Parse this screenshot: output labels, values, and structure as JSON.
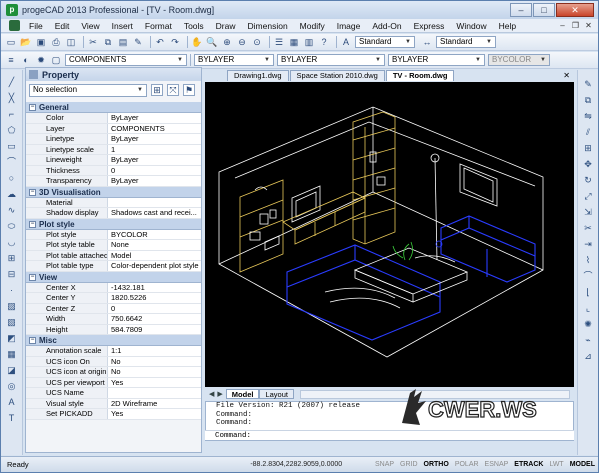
{
  "window": {
    "title": "progeCAD 2013 Professional - [TV - Room.dwg]",
    "min": "–",
    "max": "□",
    "close": "✕"
  },
  "menu": [
    "File",
    "Edit",
    "View",
    "Insert",
    "Format",
    "Tools",
    "Draw",
    "Dimension",
    "Modify",
    "Image",
    "Add-On",
    "Express",
    "Window",
    "Help"
  ],
  "toolbar": {
    "text_style": "Standard",
    "dim_style": "Standard",
    "layer": "COMPONENTS",
    "color": "BYLAYER",
    "linetype": "BYLAYER",
    "lineweight": "BYLAYER",
    "plotstyle": "BYCOLOR"
  },
  "properties": {
    "title": "Property",
    "selection": "No selection",
    "categories": [
      {
        "name": "General",
        "rows": [
          [
            "Color",
            "ByLayer"
          ],
          [
            "Layer",
            "COMPONENTS"
          ],
          [
            "Linetype",
            "ByLayer"
          ],
          [
            "Linetype scale",
            "1"
          ],
          [
            "Lineweight",
            "ByLayer"
          ],
          [
            "Thickness",
            "0"
          ],
          [
            "Transparency",
            "ByLayer"
          ]
        ]
      },
      {
        "name": "3D Visualisation",
        "rows": [
          [
            "Material",
            ""
          ],
          [
            "Shadow display",
            "Shadows cast and recei..."
          ]
        ]
      },
      {
        "name": "Plot style",
        "rows": [
          [
            "Plot style",
            "BYCOLOR"
          ],
          [
            "Plot style table",
            "None"
          ],
          [
            "Plot table attached to",
            "Model"
          ],
          [
            "Plot table type",
            "Color-dependent plot style"
          ]
        ]
      },
      {
        "name": "View",
        "rows": [
          [
            "Center X",
            "-1432.181"
          ],
          [
            "Center Y",
            "1820.5226"
          ],
          [
            "Center Z",
            "0"
          ],
          [
            "Width",
            "750.6642"
          ],
          [
            "Height",
            "584.7809"
          ]
        ]
      },
      {
        "name": "Misc",
        "rows": [
          [
            "Annotation scale",
            "1:1"
          ],
          [
            "UCS icon On",
            "No"
          ],
          [
            "UCS icon at origin",
            "No"
          ],
          [
            "UCS per viewport",
            "Yes"
          ],
          [
            "UCS Name",
            ""
          ],
          [
            "Visual style",
            "2D Wireframe"
          ],
          [
            "Set PICKADD",
            "Yes"
          ]
        ]
      }
    ]
  },
  "tabs": [
    "Drawing1.dwg",
    "Space Station 2010.dwg",
    "TV - Room.dwg"
  ],
  "active_tab": "TV - Room.dwg",
  "layout_tabs": [
    "Model",
    "Layout"
  ],
  "command_lines": [
    "File Version: R21 (2007) release",
    "Command:",
    "Command:"
  ],
  "command_prompt": "Command:",
  "watermark": "CWER.WS",
  "status": {
    "ready": "Ready",
    "coords": "-88.2.8304,2282.9059,0.0000",
    "toggles": [
      {
        "label": "SNAP",
        "on": false
      },
      {
        "label": "GRID",
        "on": false
      },
      {
        "label": "ORTHO",
        "on": true
      },
      {
        "label": "POLAR",
        "on": false
      },
      {
        "label": "ESNAP",
        "on": false
      },
      {
        "label": "ETRACK",
        "on": true
      },
      {
        "label": "LWT",
        "on": false
      },
      {
        "label": "MODEL",
        "on": true
      }
    ]
  },
  "colors": {
    "accent": "#5b7fae",
    "canvas_bg": "#000000",
    "model_white": "#ffffff",
    "model_yellow": "#e8c85a",
    "model_blue": "#2a3cff",
    "model_green": "#3ccf3c"
  }
}
